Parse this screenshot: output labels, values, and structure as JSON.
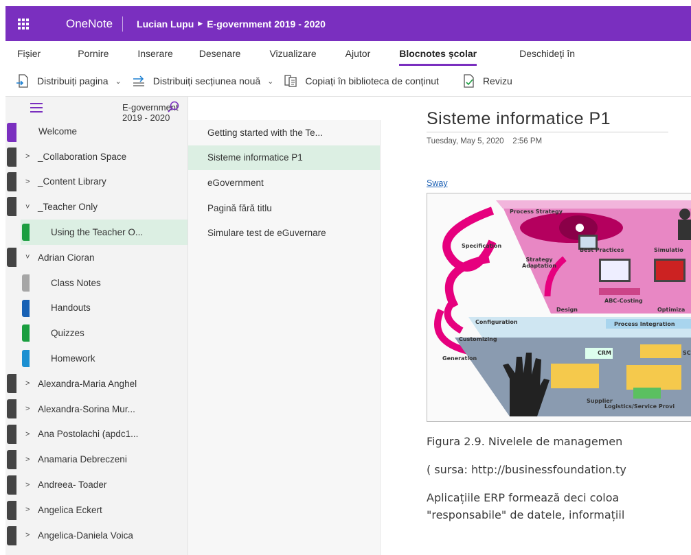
{
  "app": {
    "name": "OneNote",
    "breadcrumb_owner": "Lucian Lupu",
    "breadcrumb_notebook": "E-government 2019 - 2020"
  },
  "ribbon_tabs": [
    "Fișier",
    "Pornire",
    "Inserare",
    "Desenare",
    "Vizualizare",
    "Ajutor",
    "Blocnotes școlar",
    "Deschideți în"
  ],
  "active_tab": "Blocnotes școlar",
  "toolbar": {
    "distribute_page": "Distribuiți pagina",
    "distribute_section": "Distribuiți secțiunea nouă",
    "copy_library": "Copiați în biblioteca de conținut",
    "review": "Revizu"
  },
  "sections_pane": {
    "notebook_title": "E-government 2019 - 2020",
    "items": [
      {
        "label": "Welcome",
        "toggle": "",
        "level": 0
      },
      {
        "label": "_Collaboration Space",
        "toggle": ">",
        "level": 0
      },
      {
        "label": "_Content Library",
        "toggle": ">",
        "level": 0
      },
      {
        "label": "_Teacher Only",
        "toggle": "˅",
        "level": 0
      },
      {
        "label": "Using the Teacher O...",
        "toggle": "",
        "level": 1,
        "color": "#1a9e3f",
        "selected": true
      },
      {
        "label": "Adrian Cioran",
        "toggle": "˅",
        "level": 0
      },
      {
        "label": "Class Notes",
        "toggle": "",
        "level": 1,
        "color": "#a6a6a6"
      },
      {
        "label": "Handouts",
        "toggle": "",
        "level": 1,
        "color": "#1861b4"
      },
      {
        "label": "Quizzes",
        "toggle": "",
        "level": 1,
        "color": "#1a9e3f"
      },
      {
        "label": "Homework",
        "toggle": "",
        "level": 1,
        "color": "#1b8fd1"
      },
      {
        "label": "Alexandra-Maria Anghel",
        "toggle": ">",
        "level": 0
      },
      {
        "label": "Alexandra-Sorina Mur...",
        "toggle": ">",
        "level": 0
      },
      {
        "label": "Ana Postolachi (apdc1...",
        "toggle": ">",
        "level": 0
      },
      {
        "label": "Anamaria Debreczeni",
        "toggle": ">",
        "level": 0
      },
      {
        "label": "Andreea- Toader",
        "toggle": ">",
        "level": 0
      },
      {
        "label": "Angelica Eckert",
        "toggle": ">",
        "level": 0
      },
      {
        "label": "Angelica-Daniela Voica",
        "toggle": ">",
        "level": 0
      }
    ]
  },
  "pages_pane": {
    "items": [
      {
        "label": "Getting started with the Te..."
      },
      {
        "label": "Sisteme informatice P1",
        "selected": true
      },
      {
        "label": "eGovernment"
      },
      {
        "label": "Pagină fără titlu"
      },
      {
        "label": "Simulare test de eGuvernare"
      }
    ]
  },
  "page": {
    "title": "Sisteme informatice P1",
    "date": "Tuesday, May 5, 2020",
    "time": "2:56 PM",
    "link": "Sway",
    "figure_labels": {
      "specification": "Specification",
      "process_strategy": "Process Strategy",
      "strategy_adaptation": "Strategy\nAdaptation",
      "best_practices": "Best Practices",
      "simulation": "Simulatio",
      "abc_costing": "ABC-Costing",
      "design": "Design",
      "optimization": "Optimiza",
      "configuration": "Configuration",
      "process_integration": "Process Integration",
      "customizing": "Customizing",
      "generation": "Generation",
      "crm": "CRM",
      "sc": "SC",
      "supplier": "Supplier",
      "logistics": "Logistics/Service Provi"
    },
    "caption": "Figura 2.9. Nivelele de managemen",
    "source": "( sursa: http://businessfoundation.ty",
    "para_line1": "Aplicațiile ERP formează deci coloa",
    "para_line2": "\"responsabile\" de datele, informațiil"
  },
  "colors": {
    "brand": "#7a2fbf",
    "selected_bg": "#dcefe3"
  }
}
